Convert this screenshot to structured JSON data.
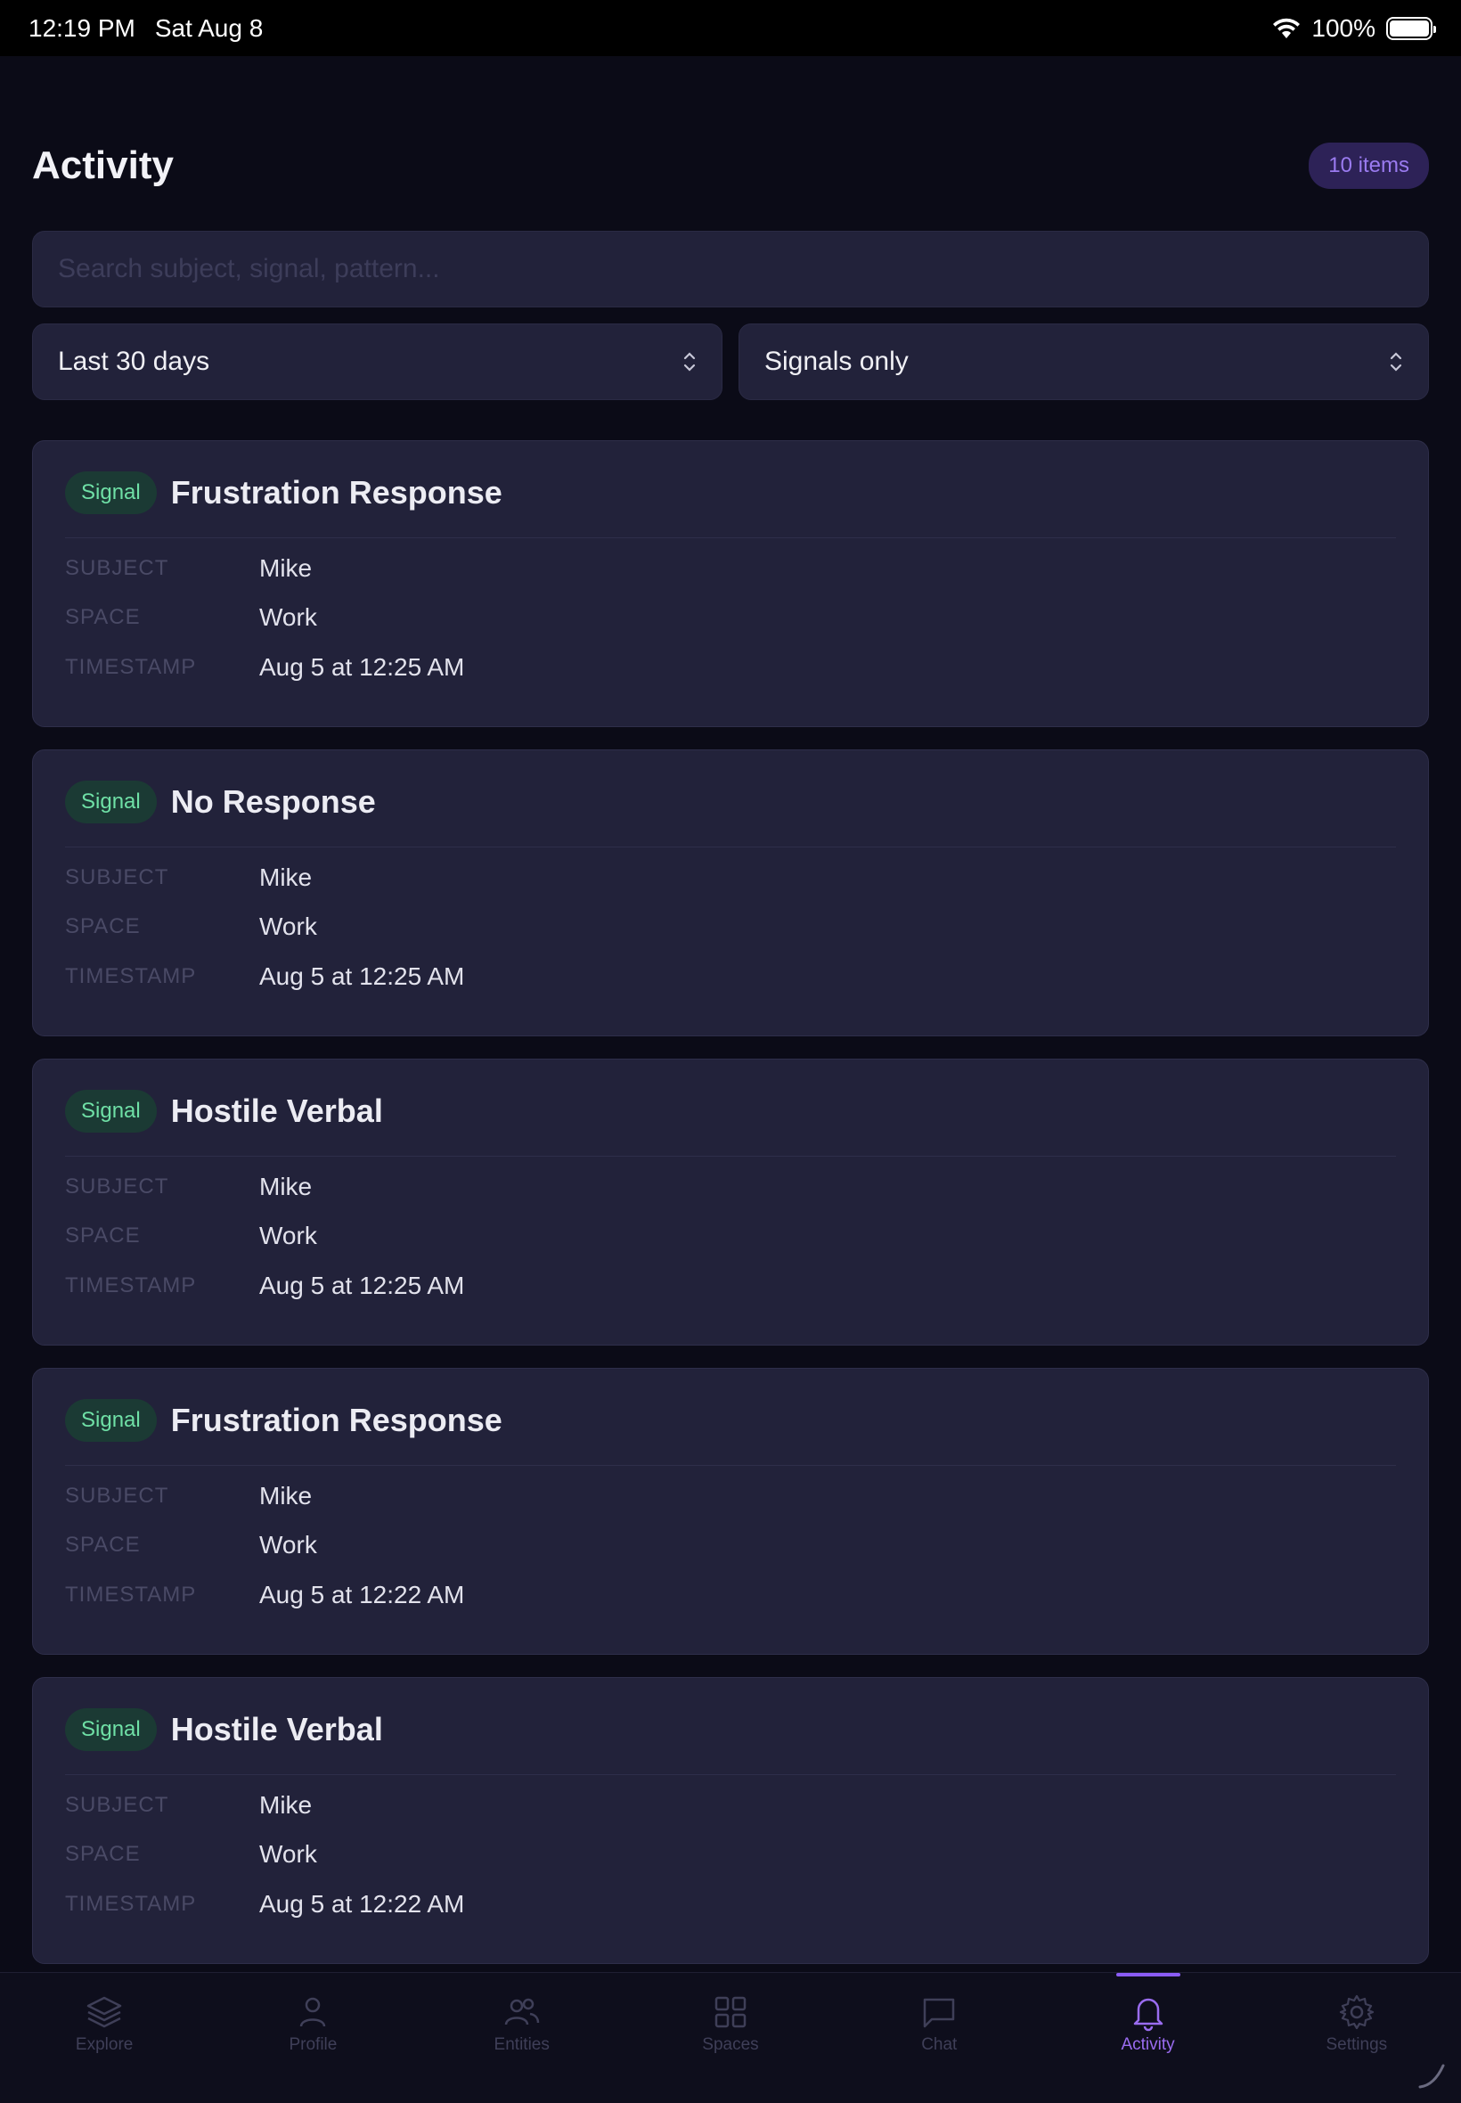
{
  "status_bar": {
    "time": "12:19 PM",
    "date": "Sat Aug 8",
    "battery": "100%"
  },
  "header": {
    "title": "Activity",
    "count": "10 items"
  },
  "search": {
    "placeholder": "Search subject, signal, pattern..."
  },
  "filters": {
    "range": "Last 30 days",
    "type": "Signals only"
  },
  "meta_labels": {
    "subject": "SUBJECT",
    "space": "SPACE",
    "timestamp": "TIMESTAMP"
  },
  "cards": [
    {
      "badge": "Signal",
      "title": "Frustration Response",
      "subject": "Mike",
      "space": "Work",
      "timestamp": "Aug 5 at 12:25 AM"
    },
    {
      "badge": "Signal",
      "title": "No Response",
      "subject": "Mike",
      "space": "Work",
      "timestamp": "Aug 5 at 12:25 AM"
    },
    {
      "badge": "Signal",
      "title": "Hostile Verbal",
      "subject": "Mike",
      "space": "Work",
      "timestamp": "Aug 5 at 12:25 AM"
    },
    {
      "badge": "Signal",
      "title": "Frustration Response",
      "subject": "Mike",
      "space": "Work",
      "timestamp": "Aug 5 at 12:22 AM"
    },
    {
      "badge": "Signal",
      "title": "Hostile Verbal",
      "subject": "Mike",
      "space": "Work",
      "timestamp": "Aug 5 at 12:22 AM"
    }
  ],
  "tabs": [
    {
      "label": "Explore",
      "icon": "layers-icon",
      "active": false
    },
    {
      "label": "Profile",
      "icon": "person-icon",
      "active": false
    },
    {
      "label": "Entities",
      "icon": "people-icon",
      "active": false
    },
    {
      "label": "Spaces",
      "icon": "grid-icon",
      "active": false
    },
    {
      "label": "Chat",
      "icon": "chat-bubble-icon",
      "active": false
    },
    {
      "label": "Activity",
      "icon": "bell-icon",
      "active": true
    },
    {
      "label": "Settings",
      "icon": "gear-icon",
      "active": false
    }
  ],
  "colors": {
    "background": "#0b0b17",
    "card": "#22223a",
    "accent": "#9a6cf0",
    "signal_badge_bg": "#1b3a34",
    "signal_badge_text": "#6fe0a6"
  }
}
